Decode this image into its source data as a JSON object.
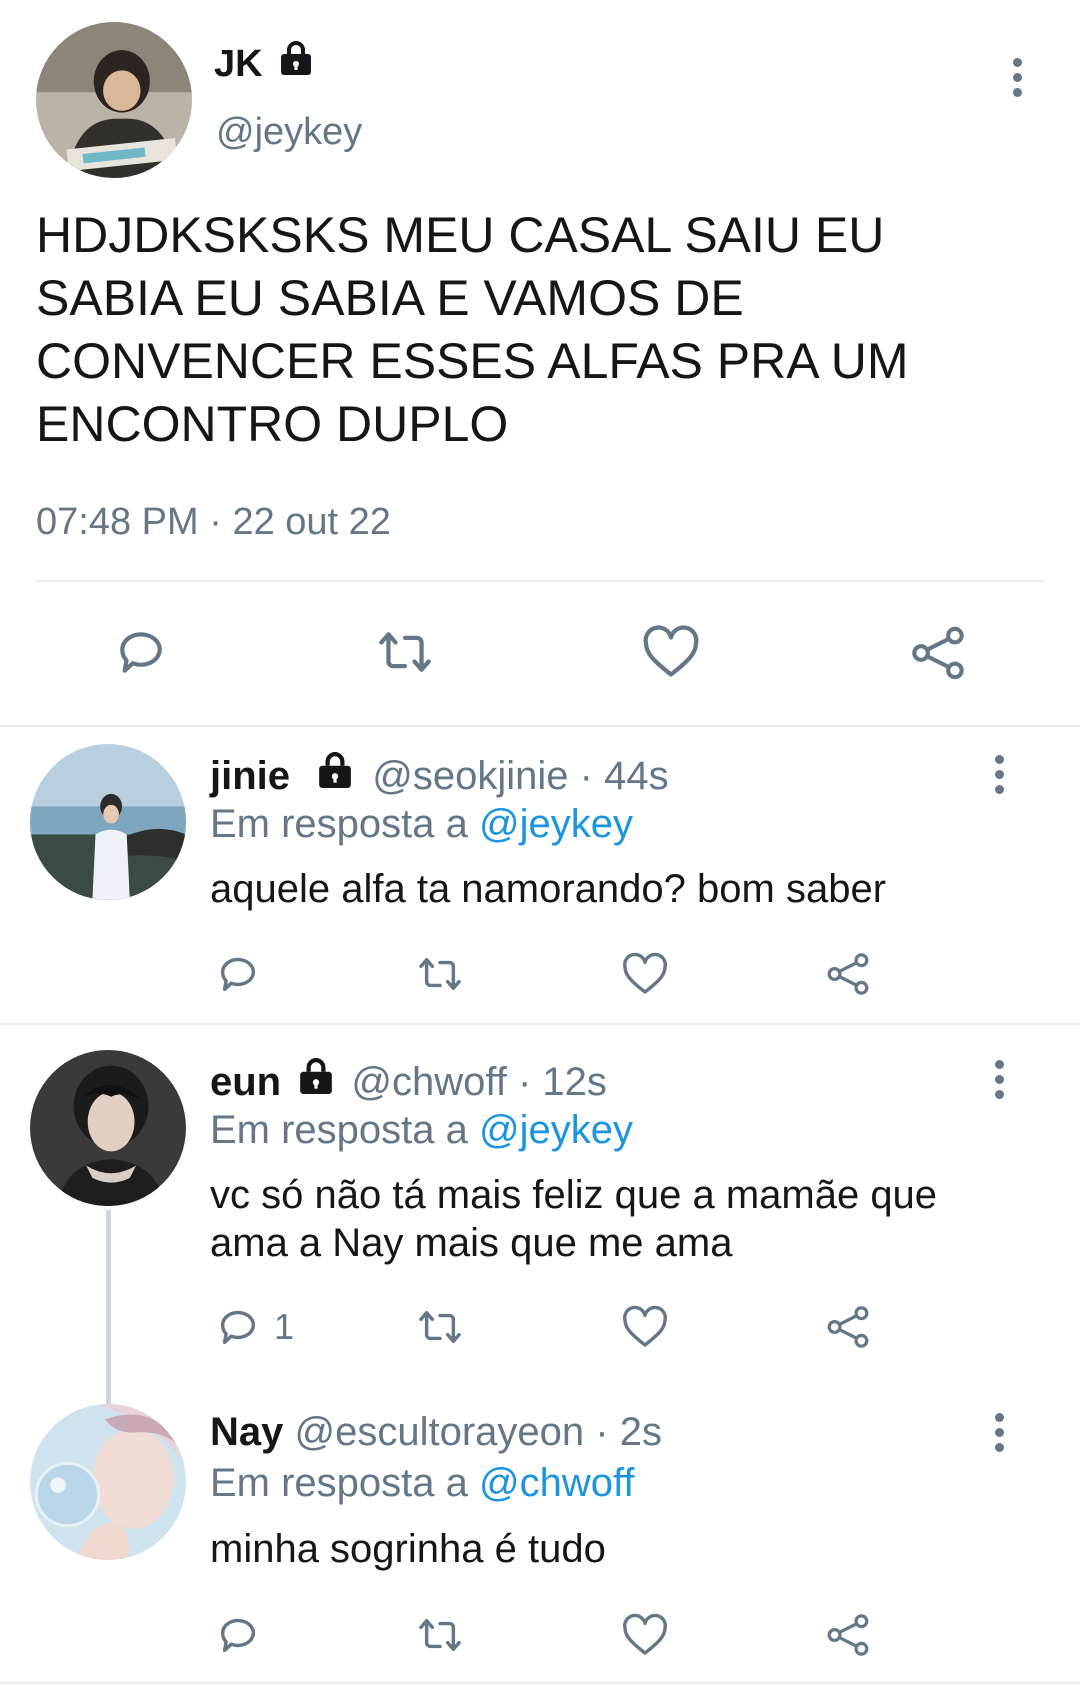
{
  "main_tweet": {
    "name": "JK",
    "handle": "@jeykey",
    "text": "HDJDKSKSKS MEU CASAL SAIU EU SABIA EU SABIA E VAMOS DE CONVENCER ESSES ALFAS PRA UM ENCONTRO DUPLO",
    "time": "07:48 PM",
    "separator": "·",
    "date": "22 out 22"
  },
  "replies": [
    {
      "name": "jinie",
      "handle": "@seokjinie",
      "age": "· 44s",
      "reply_prefix": "Em resposta a",
      "reply_to": "@jeykey",
      "text": "aquele alfa ta namorando? bom saber",
      "reply_count": ""
    },
    {
      "name": "eun",
      "handle": "@chwoff",
      "age": "· 12s",
      "reply_prefix": "Em resposta a",
      "reply_to": "@jeykey",
      "text": "vc só não tá mais feliz que a mamãe que ama a Nay mais que me ama",
      "reply_count": "1"
    },
    {
      "name": "Nay",
      "handle": "@escultorayeon",
      "age": "· 2s",
      "reply_prefix": "Em resposta a",
      "reply_to": "@chwoff",
      "text": "minha sogrinha é tudo",
      "reply_count": ""
    }
  ],
  "colors": {
    "text": "#14171a",
    "muted": "#657786",
    "link": "#1b95e0",
    "divider": "#e6ecf0"
  },
  "icons": [
    "lock-icon",
    "more-icon",
    "reply-icon",
    "retweet-icon",
    "like-icon",
    "share-icon"
  ]
}
